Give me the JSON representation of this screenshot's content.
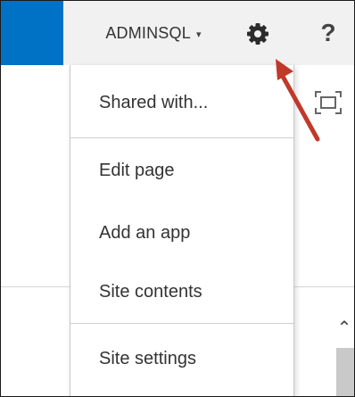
{
  "header": {
    "user_label": "ADMINSQL",
    "user_caret": "▾",
    "help_label": "?"
  },
  "menu": {
    "items": [
      {
        "label": "Shared with..."
      },
      {
        "label": "Edit page"
      },
      {
        "label": "Add an app"
      },
      {
        "label": "Site contents"
      },
      {
        "label": "Site settings"
      }
    ]
  },
  "scrollbar": {
    "up_glyph": "⌃"
  },
  "colors": {
    "brand_blue": "#0072c6",
    "annotation_arrow": "#c0392b"
  },
  "icons": [
    "settings-gear-icon",
    "help-icon",
    "focus-on-content-icon",
    "scroll-up-icon"
  ]
}
